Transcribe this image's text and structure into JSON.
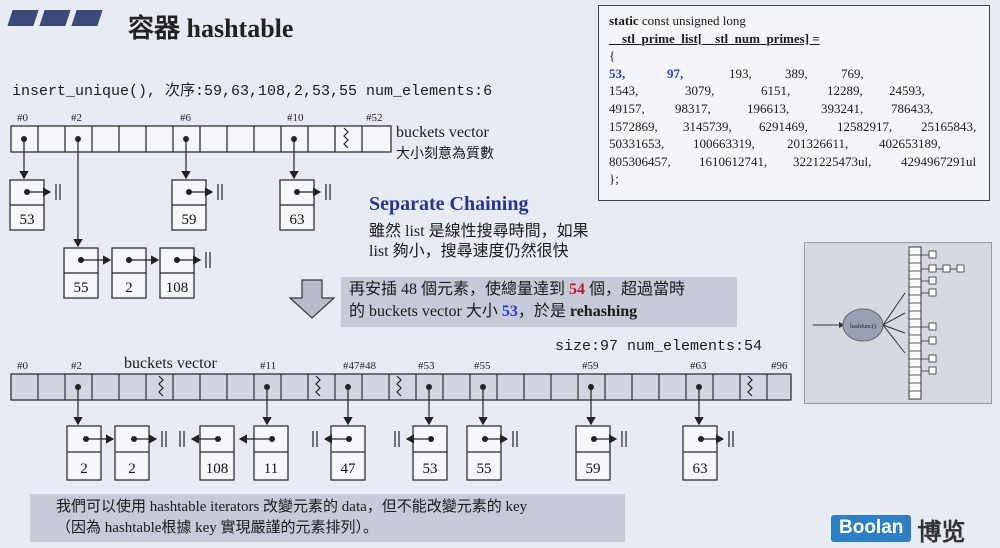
{
  "title": "容器 hashtable",
  "insert_line": "insert_unique(), 次序:59,63,108,2,53,55 num_elements:6",
  "buckets_label_top": "buckets  vector",
  "buckets_note": "大小刻意為質數",
  "top_bucket_labels": [
    "#0",
    "#2",
    "#6",
    "#10",
    "#52"
  ],
  "top_nodes": [
    "53",
    "59",
    "63",
    "55",
    "2",
    "108"
  ],
  "separate_chaining": {
    "title": "Separate Chaining",
    "line1": "雖然 list 是線性搜尋時間，如果",
    "line2": "list 夠小，搜尋速度仍然很快"
  },
  "rehash": {
    "line1_a": "再安插 48 個元素，使總量達到 ",
    "line1_b": "54",
    "line1_c": " 個，超過當時",
    "line2_a": "的 buckets vector 大小 ",
    "line2_b": "53",
    "line2_c": "，於是 ",
    "line2_d": "rehashing"
  },
  "size_line": "size:97  num_elements:54",
  "buckets_label_bottom": "buckets  vector",
  "bottom_bucket_labels": [
    "#0",
    "#2",
    "#11",
    "#47#48",
    "#53",
    "#55",
    "#59",
    "#63",
    "#96"
  ],
  "bottom_nodes": [
    "2",
    "2",
    "108",
    "11",
    "47",
    "53",
    "55",
    "59",
    "63"
  ],
  "primes": {
    "header1_a": "static",
    "header1_b": " const unsigned long",
    "header2": "__stl_prime_list[__stl_num_primes] =",
    "brace": "{",
    "hl1": "53,",
    "hl2": "97,",
    "rows": [
      [
        "193,",
        "389,",
        "769,"
      ],
      [
        "1543,",
        "3079,",
        "6151,",
        "12289,",
        "24593,"
      ],
      [
        "49157,",
        "98317,",
        "196613,",
        "393241,",
        "786433,"
      ],
      [
        "1572869,",
        "3145739,",
        "6291469,",
        "12582917,",
        "25165843,"
      ],
      [
        "50331653,",
        "100663319,",
        "201326611,",
        "402653189,"
      ],
      [
        "805306457,",
        "1610612741,",
        "3221225473ul,",
        "4294967291ul"
      ]
    ],
    "close": "};"
  },
  "hash_figure_label": "hashfunc()",
  "footer": {
    "line1": "我們可以使用 hashtable iterators 改變元素的 data，但不能改變元素的 key",
    "line2": "（因為 hashtable根據 key 實現嚴謹的元素排列）。"
  },
  "brand": {
    "en": "Boolan",
    "cn": "博览"
  },
  "colors": {
    "accent_blue": "#2a3ad0",
    "accent_red": "#c0182a",
    "title_blue": "#27358f",
    "box_gray": "#c7cad9",
    "brand_blue": "#2f7fc4"
  }
}
